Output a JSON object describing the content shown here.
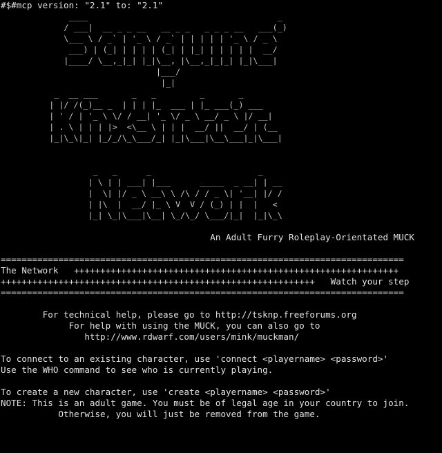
{
  "terminal": {
    "mcp_line": "#$#mcp version: \"2.1\" to: \"2.1\"",
    "logo_lines": [
      "              ____                                       _",
      "             / ___|  __ _ _ __   __ _ _   _ _ _ __   ___(_)",
      "             \\___ \\ / _` | '_ \\ / _` | | | | | '_ \\ / _ \\ ",
      "              ___) | (_| | | | | (_| | |_| | | | | |  __/",
      "             |____/ \\__,_|_| |_|\\__, |\\__,_|_|_| |_|\\___|",
      "                                |___/                    ",
      "                                 |_|                     ",
      "           _  __ ___       _   _         _       _",
      "          | |/ /(_)__ _  | | | |_  ___ | |_ ___(_) ___",
      "          | ' / | '_ \\ \\/ / __| '_ \\/ _ \\ __/ _ \\ |/ __|",
      "          | . \\ | | | |>  <\\__ \\ | | |  __/ ||  __/ | (__",
      "          |_|\\_\\|_| |_/_/\\_\\___/_| |_|\\___|\\__\\___|_|\\___|",
      "",
      "",
      "                   _   _      _                      _",
      "                  | \\ | | ___| |___      _____  _ __| | __",
      "                  |  \\| |/ _ \\ __\\ \\ /\\ / / _ \\| '__| |/ /",
      "                  | |\\  |  __/ |_ \\ V  V / (_) | |  |   <",
      "                  |_| \\_|\\___|\\__| \\_/\\_/ \\___/|_|  |_|\\_\\"
    ],
    "tagline": "                                        An Adult Furry Roleplay-Orientated MUCK",
    "blank": "",
    "rule_top": "=============================================================================",
    "network_row": "The Network   ++++++++++++++++++++++++++++++++++++++++++++++++++++++++++++++",
    "step_row": "++++++++++++++++++++++++++++++++++++++++++++++++++++++++++++   Watch your step",
    "rule_bottom": "=============================================================================",
    "help_line_1": "        For technical help, please go to http://tsknp.freeforums.org",
    "help_line_2": "             For help with using the MUCK, you can also go to",
    "help_line_3": "                http://www.rdwarf.com/users/mink/muckman/",
    "connect_line_1": "To connect to an existing character, use 'connect <playername> <password>'",
    "connect_line_2": "Use the WHO command to see who is currently playing.",
    "create_line": "To create a new character, use 'create <playername> <password>'",
    "note_line_1": "NOTE: This is an adult game. You must be of legal age in your country to join.",
    "note_line_2": "           Otherwise, you will just be removed from the game."
  },
  "colors": {
    "background": "#000000",
    "text": "#c8c8c8"
  }
}
